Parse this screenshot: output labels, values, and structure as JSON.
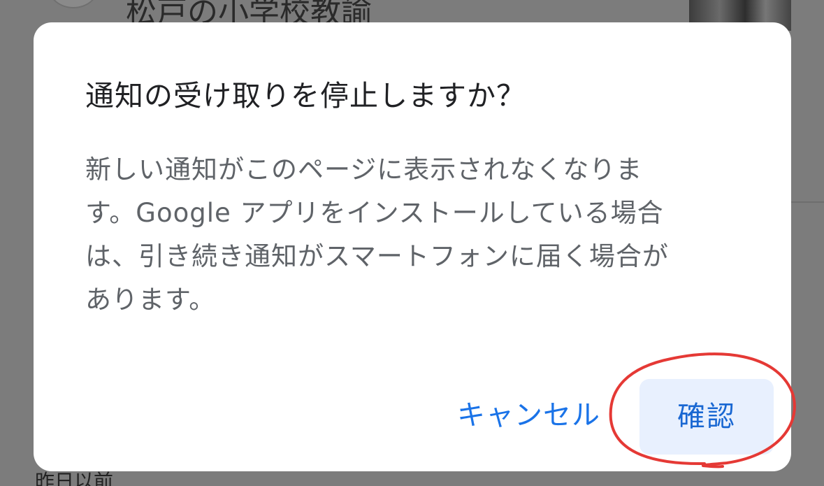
{
  "background": {
    "article_title": "松戸の小学校教諭",
    "section_label": "昨日以前"
  },
  "dialog": {
    "title": "通知の受け取りを停止しますか？",
    "body_lines": [
      "新しい通知がこのページに表示されなくなりま",
      "す。Google アプリをインストールしている場合",
      "は、引き続き通知がスマートフォンに届く場合が",
      "あります。"
    ],
    "cancel_label": "キャンセル",
    "confirm_label": "確認"
  },
  "colors": {
    "accent": "#1a73e8",
    "confirm_bg": "#e8f0fe",
    "annotation": "#e53935"
  }
}
